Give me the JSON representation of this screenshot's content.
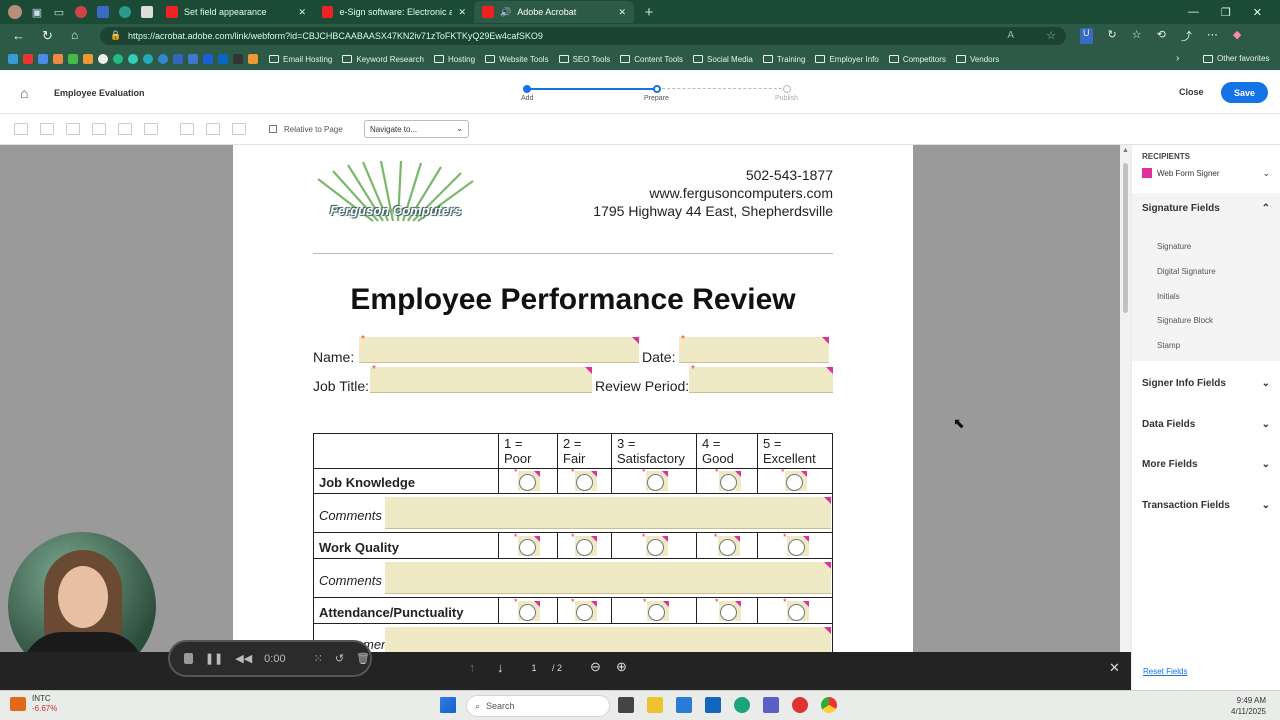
{
  "browser": {
    "tabs": [
      {
        "label": "Set field appearance"
      },
      {
        "label": "e-Sign software: Electronic and d"
      },
      {
        "label": "Adobe Acrobat"
      }
    ],
    "url": "https://acrobat.adobe.com/link/webform?id=CBJCHBCAABAASX47KN2iv71zToFKTKyQ29Ew4cafSKO9",
    "bookmarks": [
      "Email Hosting",
      "Keyword Research",
      "Hosting",
      "Website Tools",
      "SEO Tools",
      "Content Tools",
      "Social Media",
      "Training",
      "Employer Info",
      "Competitors",
      "Vendors"
    ],
    "other_favorites": "Other favorites"
  },
  "app": {
    "title": "Employee Evaluation",
    "steps": [
      "Add",
      "Prepare",
      "Publish"
    ],
    "close_label": "Close",
    "save_label": "Save",
    "relative_label": "Relative to Page",
    "navigate_label": "Navigate to..."
  },
  "document": {
    "phone": "502-543-1877",
    "website": "www.fergusoncomputers.com",
    "address": "1795 Highway 44 East, Shepherdsville",
    "logo_text": "Ferguson Computers",
    "heading": "Employee Performance Review",
    "name_label": "Name:",
    "date_label": "Date:",
    "job_title_label": "Job Title:",
    "review_period_label": "Review Period:",
    "rating_headers": [
      {
        "num": "1 =",
        "text": "Poor"
      },
      {
        "num": "2 =",
        "text": "Fair"
      },
      {
        "num": "3 =",
        "text": "Satisfactory"
      },
      {
        "num": "4 =",
        "text": "Good"
      },
      {
        "num": "5 =",
        "text": "Excellent"
      }
    ],
    "criteria": [
      "Job Knowledge",
      "Work Quality",
      "Attendance/Punctuality"
    ],
    "comments_label": "Comments",
    "partial_comments": "ments"
  },
  "panel": {
    "recipients_title": "RECIPIENTS",
    "recipient": "Web Form Signer",
    "recipient_color": "#e0319a",
    "signature_fields_title": "Signature Fields",
    "signature_fields": [
      "Signature",
      "Digital Signature",
      "Initials",
      "Signature Block",
      "Stamp"
    ],
    "sections": [
      "Signer Info Fields",
      "Data Fields",
      "More Fields",
      "Transaction Fields"
    ],
    "reset_label": "Reset Fields"
  },
  "pager": {
    "current": "1",
    "total": "/ 2"
  },
  "recorder": {
    "time": "0:00"
  },
  "taskbar": {
    "ticker": "INTC",
    "change": "-6.67%",
    "search_placeholder": "Search",
    "time": "9:49 AM",
    "date": "4/11/2025"
  },
  "colors": {
    "accent": "#1473e6",
    "browser_dark": "#1b4a37",
    "required_marker": "#e0319a",
    "field_fill": "#efe9c6"
  }
}
